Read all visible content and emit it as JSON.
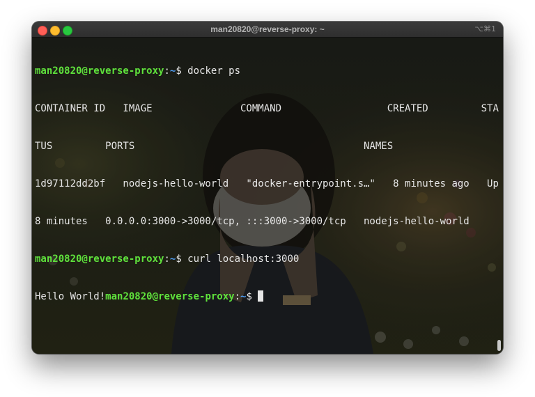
{
  "window": {
    "title": "man20820@reverse-proxy: ~",
    "shortcut": "⌥⌘1"
  },
  "terminal": {
    "prompt_user": "man20820@reverse-proxy",
    "prompt_path": "~",
    "prompt_symbol": "$",
    "cmd1": " docker ps",
    "header1": "CONTAINER ID   IMAGE               COMMAND                  CREATED         STA",
    "header2": "TUS         PORTS                                       NAMES",
    "row1": "1d97112dd2bf   nodejs-hello-world   \"docker-entrypoint.s…\"   8 minutes ago   Up",
    "row2": "8 minutes   0.0.0.0:3000->3000/tcp, :::3000->3000/tcp   nodejs-hello-world",
    "cmd2": " curl localhost:3000",
    "output": "Hello World!"
  },
  "colors": {
    "user": "#5fe23c",
    "path": "#4f9cf0",
    "text": "#e6e6e6"
  }
}
